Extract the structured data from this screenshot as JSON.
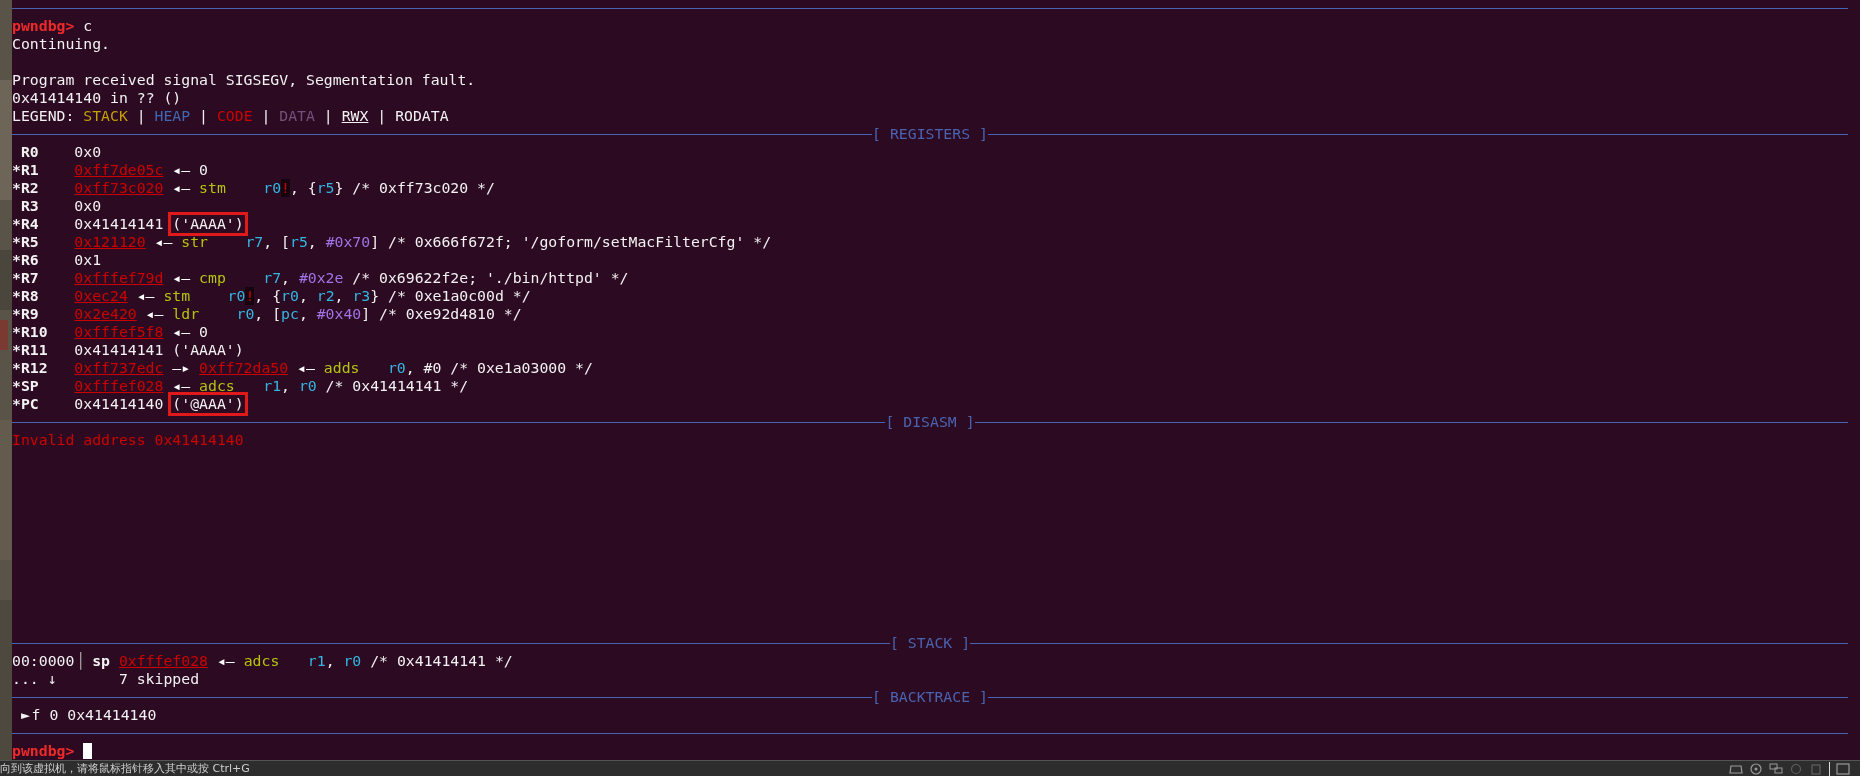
{
  "intro": [
    {
      "parts": [
        {
          "kind": "prompt",
          "text": "pwndbg>"
        },
        {
          "kind": "plain",
          "text": " c"
        }
      ]
    },
    {
      "parts": [
        {
          "kind": "plain",
          "text": "Continuing."
        }
      ]
    },
    {
      "gap_before": true,
      "parts": [
        {
          "kind": "plain",
          "text": "Program received signal SIGSEGV, Segmentation fault."
        }
      ]
    },
    {
      "parts": [
        {
          "kind": "plain",
          "text": "0x41414140 in ?? ()"
        }
      ]
    }
  ],
  "legend": {
    "label": "LEGEND:",
    "separator": "|",
    "items": [
      {
        "kind": "stack",
        "text": "STACK"
      },
      {
        "kind": "heap",
        "text": "HEAP"
      },
      {
        "kind": "code",
        "text": "CODE"
      },
      {
        "kind": "data",
        "text": "DATA"
      },
      {
        "kind": "rwx",
        "text": "RWX"
      },
      {
        "kind": "rodata",
        "text": "RODATA"
      }
    ]
  },
  "registers_title": "[ REGISTERS ]",
  "registers": [
    {
      "name": "R0",
      "changed": false,
      "parts": [
        {
          "kind": "plain",
          "text": "0x0"
        }
      ]
    },
    {
      "name": "*R1",
      "changed": true,
      "parts": [
        {
          "kind": "addr",
          "text": "0xff7de05c"
        },
        {
          "kind": "arrow",
          "text": "◂—"
        },
        {
          "kind": "plain",
          "text": "0"
        }
      ]
    },
    {
      "name": "*R2",
      "changed": true,
      "parts": [
        {
          "kind": "addr",
          "text": "0xff73c020"
        },
        {
          "kind": "arrow",
          "text": "◂—"
        },
        {
          "kind": "op",
          "text": "stm"
        },
        {
          "kind": "reg",
          "text": "r0"
        },
        {
          "kind": "bang",
          "text": "!"
        },
        {
          "kind": "plain",
          "text": ", {"
        },
        {
          "kind": "reg",
          "text": "r5"
        },
        {
          "kind": "plain",
          "text": "}"
        },
        {
          "kind": "comment",
          "text": "/* 0xff73c020 */"
        }
      ]
    },
    {
      "name": "R3",
      "changed": false,
      "parts": [
        {
          "kind": "plain",
          "text": "0x0"
        }
      ]
    },
    {
      "name": "*R4",
      "changed": true,
      "parts": [
        {
          "kind": "plain",
          "text": "0x41414141"
        },
        {
          "kind": "boxed",
          "text": "('AAAA')"
        }
      ]
    },
    {
      "name": "*R5",
      "changed": true,
      "parts": [
        {
          "kind": "addr",
          "text": "0x121120"
        },
        {
          "kind": "arrow",
          "text": "◂—"
        },
        {
          "kind": "op",
          "text": "str"
        },
        {
          "kind": "reg",
          "text": "r7"
        },
        {
          "kind": "plain",
          "text": ", ["
        },
        {
          "kind": "reg",
          "text": "r5"
        },
        {
          "kind": "plain",
          "text": ", "
        },
        {
          "kind": "imm",
          "text": "#0x70"
        },
        {
          "kind": "plain",
          "text": "]"
        },
        {
          "kind": "comment",
          "text": "/* 0x666f672f; '/goform/setMacFilterCfg' */"
        }
      ]
    },
    {
      "name": "*R6",
      "changed": true,
      "parts": [
        {
          "kind": "plain",
          "text": "0x1"
        }
      ]
    },
    {
      "name": "*R7",
      "changed": true,
      "parts": [
        {
          "kind": "addr",
          "text": "0xfffef79d"
        },
        {
          "kind": "arrow",
          "text": "◂—"
        },
        {
          "kind": "op",
          "text": "cmp"
        },
        {
          "kind": "reg",
          "text": "r7"
        },
        {
          "kind": "plain",
          "text": ", "
        },
        {
          "kind": "imm",
          "text": "#0x2e"
        },
        {
          "kind": "comment",
          "text": "/* 0x69622f2e; './bin/httpd' */"
        }
      ]
    },
    {
      "name": "*R8",
      "changed": true,
      "parts": [
        {
          "kind": "addr",
          "text": "0xec24"
        },
        {
          "kind": "arrow",
          "text": "◂—"
        },
        {
          "kind": "op",
          "text": "stm"
        },
        {
          "kind": "reg",
          "text": "r0"
        },
        {
          "kind": "bang",
          "text": "!"
        },
        {
          "kind": "plain",
          "text": ", {"
        },
        {
          "kind": "reg",
          "text": "r0"
        },
        {
          "kind": "plain",
          "text": ", "
        },
        {
          "kind": "reg",
          "text": "r2"
        },
        {
          "kind": "plain",
          "text": ", "
        },
        {
          "kind": "reg",
          "text": "r3"
        },
        {
          "kind": "plain",
          "text": "}"
        },
        {
          "kind": "comment",
          "text": "/* 0xe1a0c00d */"
        }
      ]
    },
    {
      "name": "*R9",
      "changed": true,
      "parts": [
        {
          "kind": "addr",
          "text": "0x2e420"
        },
        {
          "kind": "arrow",
          "text": "◂—"
        },
        {
          "kind": "op",
          "text": "ldr"
        },
        {
          "kind": "reg",
          "text": "r0"
        },
        {
          "kind": "plain",
          "text": ", ["
        },
        {
          "kind": "reg",
          "text": "pc"
        },
        {
          "kind": "plain",
          "text": ", "
        },
        {
          "kind": "imm",
          "text": "#0x40"
        },
        {
          "kind": "plain",
          "text": "]"
        },
        {
          "kind": "comment",
          "text": "/* 0xe92d4810 */"
        }
      ]
    },
    {
      "name": "*R10",
      "changed": true,
      "parts": [
        {
          "kind": "addr",
          "text": "0xfffef5f8"
        },
        {
          "kind": "arrow",
          "text": "◂—"
        },
        {
          "kind": "plain",
          "text": "0"
        }
      ]
    },
    {
      "name": "*R11",
      "changed": true,
      "parts": [
        {
          "kind": "plain",
          "text": "0x41414141 ('AAAA')"
        }
      ]
    },
    {
      "name": "*R12",
      "changed": true,
      "parts": [
        {
          "kind": "addr",
          "text": "0xff737edc"
        },
        {
          "kind": "arrow",
          "text": "—▸"
        },
        {
          "kind": "addr",
          "text": "0xff72da50"
        },
        {
          "kind": "arrow",
          "text": "◂—"
        },
        {
          "kind": "op",
          "text": "adds"
        },
        {
          "kind": "reg",
          "text": "r0"
        },
        {
          "kind": "plain",
          "text": ", #0"
        },
        {
          "kind": "comment",
          "text": "/* 0xe1a03000 */"
        }
      ]
    },
    {
      "name": "*SP",
      "changed": true,
      "parts": [
        {
          "kind": "addr",
          "text": "0xfffef028"
        },
        {
          "kind": "arrow",
          "text": "◂—"
        },
        {
          "kind": "op",
          "text": "adcs"
        },
        {
          "kind": "reg",
          "text": "r1"
        },
        {
          "kind": "plain",
          "text": ", "
        },
        {
          "kind": "reg",
          "text": "r0"
        },
        {
          "kind": "comment",
          "text": "/* 0x41414141 */"
        }
      ]
    },
    {
      "name": "*PC",
      "changed": true,
      "parts": [
        {
          "kind": "plain",
          "text": "0x41414140"
        },
        {
          "kind": "boxed",
          "text": "('@AAA')"
        }
      ]
    }
  ],
  "disasm_title": "[ DISASM ]",
  "disasm_lines": [
    "Invalid address 0x41414140"
  ],
  "stack_title": "[ STACK ]",
  "stack": [
    {
      "index": "00:0000",
      "separator": "│",
      "parts": [
        {
          "kind": "sp",
          "text": "sp"
        },
        {
          "kind": "addr",
          "text": "0xfffef028"
        },
        {
          "kind": "arrow",
          "text": "◂—"
        },
        {
          "kind": "op",
          "text": "adcs"
        },
        {
          "kind": "reg",
          "text": "r1"
        },
        {
          "kind": "plain",
          "text": ", "
        },
        {
          "kind": "reg",
          "text": "r0"
        },
        {
          "kind": "comment",
          "text": "/* 0x41414141 */"
        }
      ]
    },
    {
      "index": "... ↓",
      "parts": [
        {
          "kind": "plain",
          "text": "7 skipped"
        }
      ]
    }
  ],
  "backtrace_title": "[ BACKTRACE ]",
  "backtrace": [
    {
      "marker": "►",
      "text": "f 0 0x41414140",
      "selected": true
    }
  ],
  "prompt": "pwndbg>",
  "status_bar": {
    "message": "向到该虚拟机，请将鼠标指针移入其中或按 Ctrl+G"
  }
}
